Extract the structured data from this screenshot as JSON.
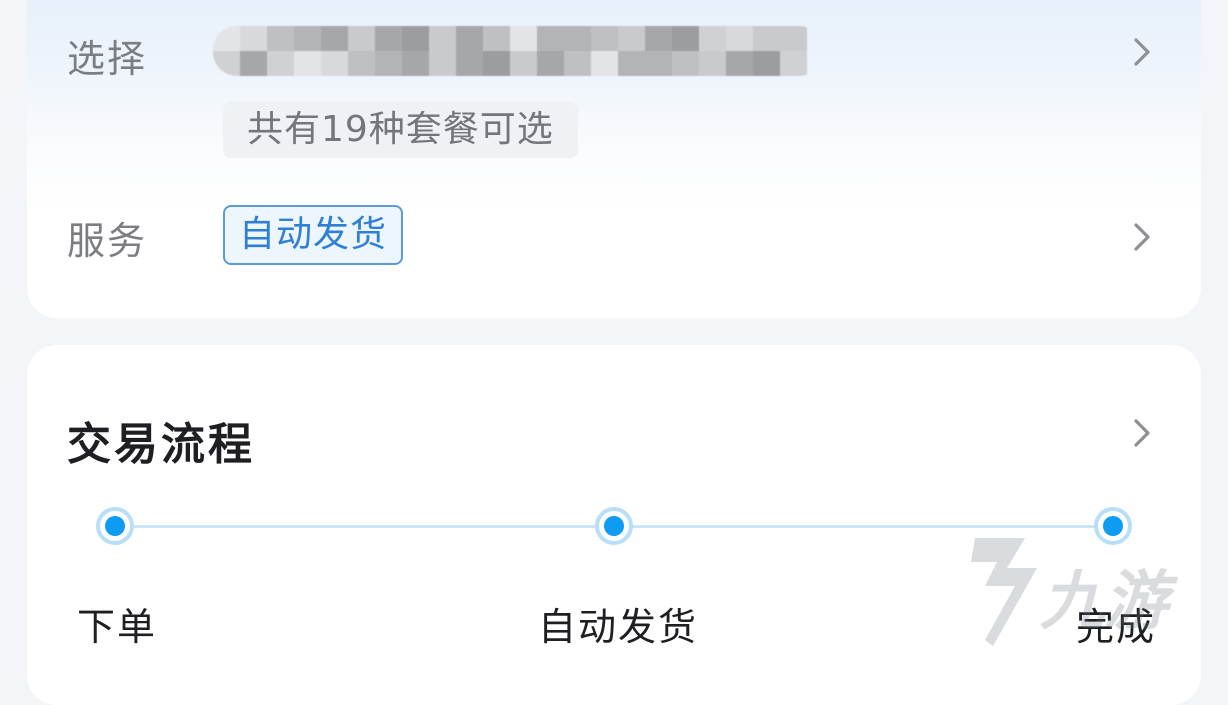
{
  "package_row": {
    "label": "选择",
    "hidden_value_icon": "blurred-mosaic",
    "count_badge": "共有19种套餐可选",
    "chevron_icon": "chevron-right-icon"
  },
  "service_row": {
    "label": "服务",
    "tag": "自动发货",
    "chevron_icon": "chevron-right-icon"
  },
  "trade_flow": {
    "title": "交易流程",
    "chevron_icon": "chevron-right-icon",
    "steps": [
      {
        "label": "下单"
      },
      {
        "label": "自动发货"
      },
      {
        "label": "完成"
      }
    ]
  },
  "watermark": {
    "text": "九游",
    "icon": "9game-logo-icon"
  },
  "colors": {
    "accent": "#0d9cf2",
    "tag_border": "#5d9bd6",
    "tag_text": "#2f7fd4",
    "label_text": "#7b7d83",
    "title_text": "#1e1f22"
  }
}
